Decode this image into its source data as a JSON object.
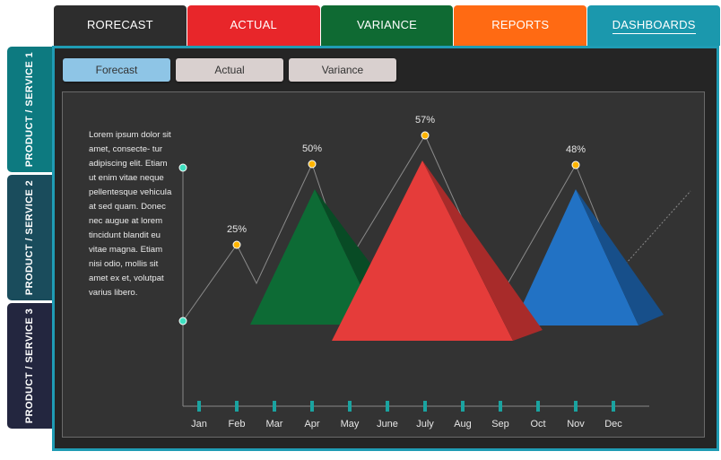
{
  "tabs": [
    {
      "label": "RORECAST",
      "color": "#2d2d2d",
      "active": false
    },
    {
      "label": "ACTUAL",
      "color": "#e8262a",
      "active": false
    },
    {
      "label": "VARIANCE",
      "color": "#0f6a33",
      "active": false
    },
    {
      "label": "REPORTS",
      "color": "#ff6a13",
      "active": false
    },
    {
      "label": "DASHBOARDS",
      "color": "#1b98ad",
      "active": true
    }
  ],
  "sidebar": [
    {
      "label": "PRODUCT / SERVICE 1",
      "color": "#0d7a80"
    },
    {
      "label": "PRODUCT / SERVICE 2",
      "color": "#1a4c5c"
    },
    {
      "label": "PRODUCT / SERVICE 3",
      "color": "#23263f"
    }
  ],
  "subtabs": [
    {
      "label": "Forecast",
      "active": true
    },
    {
      "label": "Actual",
      "active": false
    },
    {
      "label": "Variance",
      "active": false
    }
  ],
  "description": "Lorem ipsum dolor sit amet, consecte- tur adipiscing elit. Etiam ut enim vitae neque pellentesque vehicula at sed quam. Donec nec augue at lorem tincidunt blandit eu vitae magna. Etiam nisi odio, mollis sit amet ex et, volutpat varius libero.",
  "chart_data": {
    "type": "line",
    "categories": [
      "Jan",
      "Feb",
      "Mar",
      "Apr",
      "May",
      "June",
      "July",
      "Aug",
      "Sep",
      "Oct",
      "Nov",
      "Dec"
    ],
    "labeled_points": [
      {
        "category": "Feb",
        "value": "25%"
      },
      {
        "category": "Apr",
        "value": "50%"
      },
      {
        "category": "July",
        "value": "57%"
      },
      {
        "category": "Nov",
        "value": "48%"
      }
    ],
    "pyramids": [
      {
        "peak": "Apr",
        "color": "#0d6b35"
      },
      {
        "peak": "July",
        "color": "#e53c3a"
      },
      {
        "peak": "Nov",
        "color": "#2272c4"
      }
    ],
    "colors": {
      "line": "#8a8a8a",
      "marker": "#ffb400",
      "axis_marker": "#3fe0c0",
      "tick": "#1aa3a0"
    },
    "grid": false
  }
}
